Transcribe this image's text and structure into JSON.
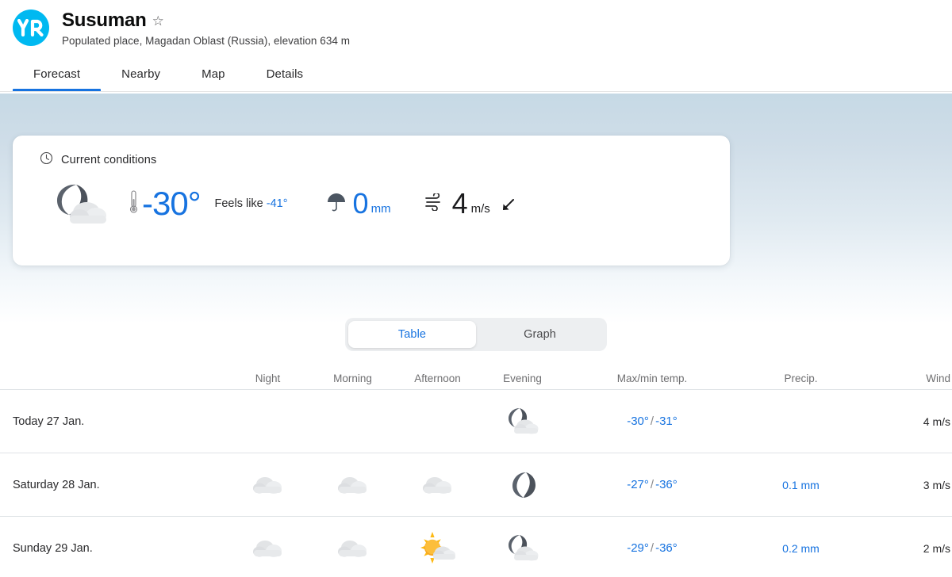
{
  "brand": {
    "logo_text": "YR",
    "logo_color": "#00b9f1"
  },
  "header": {
    "place_name": "Susuman",
    "favorite_icon": "star-outline-icon",
    "subtitle": "Populated place, Magadan Oblast (Russia), elevation 634 m"
  },
  "nav": {
    "tabs": [
      {
        "label": "Forecast",
        "active": true
      },
      {
        "label": "Nearby",
        "active": false
      },
      {
        "label": "Map",
        "active": false
      },
      {
        "label": "Details",
        "active": false
      }
    ],
    "active_underline_color": "#1773e0"
  },
  "current_conditions": {
    "title": "Current conditions",
    "clock_icon": "clock-icon",
    "weather_icon": "moon-cloud-icon",
    "thermometer_icon": "thermometer-icon",
    "temperature": "-30°",
    "feels_like_label": "Feels like",
    "feels_like_value": "-41°",
    "umbrella_icon": "umbrella-icon",
    "precipitation_value": "0",
    "precipitation_unit": "mm",
    "wind_icon": "wind-icon",
    "wind_value": "4",
    "wind_unit": "m/s",
    "wind_direction_icon": "arrow-southwest-icon",
    "accent_color": "#1773e0"
  },
  "view_toggle": {
    "options": [
      {
        "label": "Table",
        "active": true
      },
      {
        "label": "Graph",
        "active": false
      }
    ]
  },
  "forecast_table": {
    "headers": {
      "day": "",
      "night": "Night",
      "morning": "Morning",
      "afternoon": "Afternoon",
      "evening": "Evening",
      "temp": "Max/min temp.",
      "precip": "Precip.",
      "wind": "Wind"
    },
    "rows": [
      {
        "day": "Today 27 Jan.",
        "night_icon": "",
        "morning_icon": "",
        "afternoon_icon": "",
        "evening_icon": "moon-cloud-icon",
        "temp_max": "-30°",
        "temp_sep": "/",
        "temp_min": "-31°",
        "precip": "",
        "wind": "4 m/s"
      },
      {
        "day": "Saturday 28 Jan.",
        "night_icon": "cloud-icon",
        "morning_icon": "cloud-icon",
        "afternoon_icon": "cloud-icon",
        "evening_icon": "moon-icon",
        "temp_max": "-27°",
        "temp_sep": "/",
        "temp_min": "-36°",
        "precip": "0.1 mm",
        "wind": "3 m/s"
      },
      {
        "day": "Sunday 29 Jan.",
        "night_icon": "cloud-icon",
        "morning_icon": "cloud-icon",
        "afternoon_icon": "sun-cloud-icon",
        "evening_icon": "moon-cloud-icon",
        "temp_max": "-29°",
        "temp_sep": "/",
        "temp_min": "-36°",
        "precip": "0.2 mm",
        "wind": "2 m/s"
      }
    ]
  }
}
